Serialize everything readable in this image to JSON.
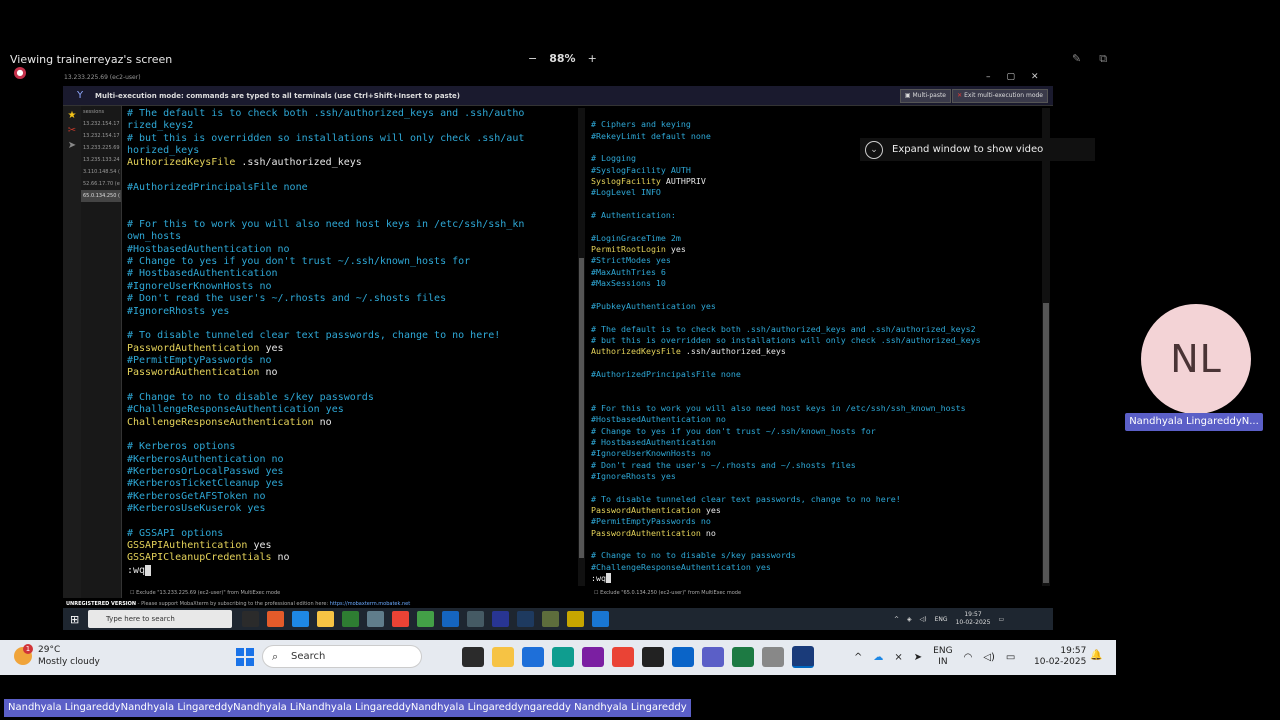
{
  "viewing": {
    "text": "Viewing trainerreyaz's screen",
    "zoom": "88%",
    "minus": "−",
    "plus": "+"
  },
  "window": {
    "title": "13.233.225.69 (ec2-user)"
  },
  "multiexec": {
    "message": "Multi-execution mode: commands are typed to all terminals (use Ctrl+Shift+Insert to paste)",
    "multipaste": "Multi-paste",
    "exit": "Exit multi-execution mode"
  },
  "sessions": [
    "sessions",
    "13.232.154.17",
    "13.232.154.17",
    "13.233.225.69",
    "13.235.133.24",
    "3.110.148.54 (",
    "52.66.17.70 (e",
    "65.0.134.250 ("
  ],
  "terminal_left": {
    "lines": [
      {
        "t": "# The default is to check both .ssh/authorized_keys and .ssh/autho",
        "k": "c"
      },
      {
        "t": "rized_keys2",
        "k": "c"
      },
      {
        "t": "# but this is overridden so installations will only check .ssh/aut",
        "k": "c"
      },
      {
        "t": "horized_keys",
        "k": "c"
      },
      {
        "t": "AuthorizedKeysFile",
        "k": "y",
        "rest": " .ssh/authorized_keys"
      },
      {
        "t": "",
        "k": "c"
      },
      {
        "t": "#AuthorizedPrincipalsFile none",
        "k": "c"
      },
      {
        "t": "",
        "k": "c"
      },
      {
        "t": "",
        "k": "c"
      },
      {
        "t": "# For this to work you will also need host keys in /etc/ssh/ssh_kn",
        "k": "c"
      },
      {
        "t": "own_hosts",
        "k": "c"
      },
      {
        "t": "#HostbasedAuthentication no",
        "k": "c"
      },
      {
        "t": "# Change to yes if you don't trust ~/.ssh/known_hosts for",
        "k": "c"
      },
      {
        "t": "# HostbasedAuthentication",
        "k": "c"
      },
      {
        "t": "#IgnoreUserKnownHosts no",
        "k": "c"
      },
      {
        "t": "# Don't read the user's ~/.rhosts and ~/.shosts files",
        "k": "c"
      },
      {
        "t": "#IgnoreRhosts yes",
        "k": "c"
      },
      {
        "t": "",
        "k": "c"
      },
      {
        "t": "# To disable tunneled clear text passwords, change to no here!",
        "k": "c"
      },
      {
        "t": "PasswordAuthentication",
        "k": "y",
        "rest": " yes"
      },
      {
        "t": "#PermitEmptyPasswords no",
        "k": "c"
      },
      {
        "t": "PasswordAuthentication",
        "k": "y",
        "rest": " no"
      },
      {
        "t": "",
        "k": "c"
      },
      {
        "t": "# Change to no to disable s/key passwords",
        "k": "c"
      },
      {
        "t": "#ChallengeResponseAuthentication yes",
        "k": "c"
      },
      {
        "t": "ChallengeResponseAuthentication",
        "k": "y",
        "rest": " no"
      },
      {
        "t": "",
        "k": "c"
      },
      {
        "t": "# Kerberos options",
        "k": "c"
      },
      {
        "t": "#KerberosAuthentication no",
        "k": "c"
      },
      {
        "t": "#KerberosOrLocalPasswd yes",
        "k": "c"
      },
      {
        "t": "#KerberosTicketCleanup yes",
        "k": "c"
      },
      {
        "t": "#KerberosGetAFSToken no",
        "k": "c"
      },
      {
        "t": "#KerberosUseKuserok yes",
        "k": "c"
      },
      {
        "t": "",
        "k": "c"
      },
      {
        "t": "# GSSAPI options",
        "k": "c"
      },
      {
        "t": "GSSAPIAuthentication",
        "k": "y",
        "rest": " yes"
      },
      {
        "t": "GSSAPICleanupCredentials",
        "k": "y",
        "rest": " no"
      },
      {
        "t": ":wq",
        "k": "w"
      }
    ]
  },
  "terminal_right": {
    "lines": [
      {
        "t": "",
        "k": "c"
      },
      {
        "t": "# Ciphers and keying",
        "k": "c"
      },
      {
        "t": "#RekeyLimit default none",
        "k": "c"
      },
      {
        "t": "",
        "k": "c"
      },
      {
        "t": "# Logging",
        "k": "c"
      },
      {
        "t": "#SyslogFacility AUTH",
        "k": "c"
      },
      {
        "t": "SyslogFacility",
        "k": "y",
        "rest": " AUTHPRIV"
      },
      {
        "t": "#LogLevel INFO",
        "k": "c"
      },
      {
        "t": "",
        "k": "c"
      },
      {
        "t": "# Authentication:",
        "k": "c"
      },
      {
        "t": "",
        "k": "c"
      },
      {
        "t": "#LoginGraceTime 2m",
        "k": "c"
      },
      {
        "t": "PermitRootLogin",
        "k": "y",
        "rest": " yes"
      },
      {
        "t": "#StrictModes yes",
        "k": "c"
      },
      {
        "t": "#MaxAuthTries 6",
        "k": "c"
      },
      {
        "t": "#MaxSessions 10",
        "k": "c"
      },
      {
        "t": "",
        "k": "c"
      },
      {
        "t": "#PubkeyAuthentication yes",
        "k": "c"
      },
      {
        "t": "",
        "k": "c"
      },
      {
        "t": "# The default is to check both .ssh/authorized_keys and .ssh/authorized_keys2",
        "k": "c"
      },
      {
        "t": "# but this is overridden so installations will only check .ssh/authorized_keys",
        "k": "c"
      },
      {
        "t": "AuthorizedKeysFile",
        "k": "y",
        "rest": " .ssh/authorized_keys"
      },
      {
        "t": "",
        "k": "c"
      },
      {
        "t": "#AuthorizedPrincipalsFile none",
        "k": "c"
      },
      {
        "t": "",
        "k": "c"
      },
      {
        "t": "",
        "k": "c"
      },
      {
        "t": "# For this to work you will also need host keys in /etc/ssh/ssh_known_hosts",
        "k": "c"
      },
      {
        "t": "#HostbasedAuthentication no",
        "k": "c"
      },
      {
        "t": "# Change to yes if you don't trust ~/.ssh/known_hosts for",
        "k": "c"
      },
      {
        "t": "# HostbasedAuthentication",
        "k": "c"
      },
      {
        "t": "#IgnoreUserKnownHosts no",
        "k": "c"
      },
      {
        "t": "# Don't read the user's ~/.rhosts and ~/.shosts files",
        "k": "c"
      },
      {
        "t": "#IgnoreRhosts yes",
        "k": "c"
      },
      {
        "t": "",
        "k": "c"
      },
      {
        "t": "# To disable tunneled clear text passwords, change to no here!",
        "k": "c"
      },
      {
        "t": "PasswordAuthentication",
        "k": "y",
        "rest": " yes"
      },
      {
        "t": "#PermitEmptyPasswords no",
        "k": "c"
      },
      {
        "t": "PasswordAuthentication",
        "k": "y",
        "rest": " no"
      },
      {
        "t": "",
        "k": "c"
      },
      {
        "t": "# Change to no to disable s/key passwords",
        "k": "c"
      },
      {
        "t": "#ChallengeResponseAuthentication yes",
        "k": "c"
      },
      {
        "t": ":wq",
        "k": "w"
      }
    ]
  },
  "exclude_left": "Exclude \"13.233.225.69 (ec2-user)\" from MultiExec mode",
  "exclude_right": "Exclude \"65.0.134.250 (ec2-user)\" from MultiExec mode",
  "unregistered": {
    "bold": "UNREGISTERED VERSION",
    "text": " -  Please support MobaXterm by subscribing to the professional edition here: ",
    "link": "https://mobaxterm.mobatek.net"
  },
  "inner_taskbar": {
    "search": "Type here to search",
    "lang": "ENG",
    "time": "19:57",
    "date": "10-02-2025"
  },
  "video": {
    "expand": "Expand window to show video",
    "initials": "NL",
    "name": "Nandhyala LingareddyN..."
  },
  "taskbar": {
    "temp": "29°C",
    "weather": "Mostly cloudy",
    "badge": "1",
    "search": "Search",
    "lang1": "ENG",
    "lang2": "IN",
    "time": "19:57",
    "date": "10-02-2025"
  },
  "namestrip": "Nandhyala LingareddyNandhyala LingareddyNandhyala LiNandhyala LingareddyNandhyala Lingareddyngareddy Nandhyala Lingareddy",
  "colors": {
    "comment": "#2ea8d6",
    "keyword": "#e5d35a",
    "teams_purple": "#5b5fc7"
  }
}
